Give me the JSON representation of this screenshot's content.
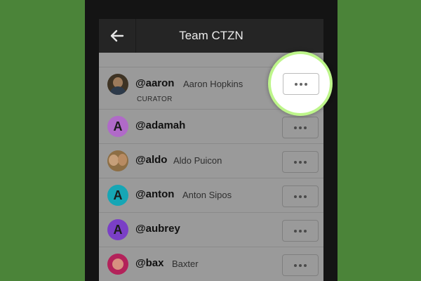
{
  "header": {
    "title": "Team CTZN",
    "back_icon": "arrow-left-icon"
  },
  "members": [
    {
      "handle": "@aaron",
      "name": "Aaron Hopkins",
      "role": "CURATOR",
      "avatar": "photo",
      "avatar_color": "#3e3324"
    },
    {
      "handle": "@adamah",
      "name": "",
      "avatar": "A",
      "avatar_color": "#b06ac8"
    },
    {
      "handle": "@aldo",
      "name": "Aldo Puicon",
      "avatar": "photo",
      "avatar_color": "#8d6e44"
    },
    {
      "handle": "@anton",
      "name": "Anton Sipos",
      "avatar": "A",
      "avatar_color": "#16a6b5"
    },
    {
      "handle": "@aubrey",
      "name": "",
      "avatar": "A",
      "avatar_color": "#7a3fc6"
    },
    {
      "handle": "@bax",
      "name": "Baxter",
      "avatar": "photo",
      "avatar_color": "#b3225a"
    }
  ],
  "colors": {
    "background": "#4b8439",
    "highlight_ring": "#bdf58a"
  },
  "icons": {
    "more": "ellipsis-icon"
  }
}
